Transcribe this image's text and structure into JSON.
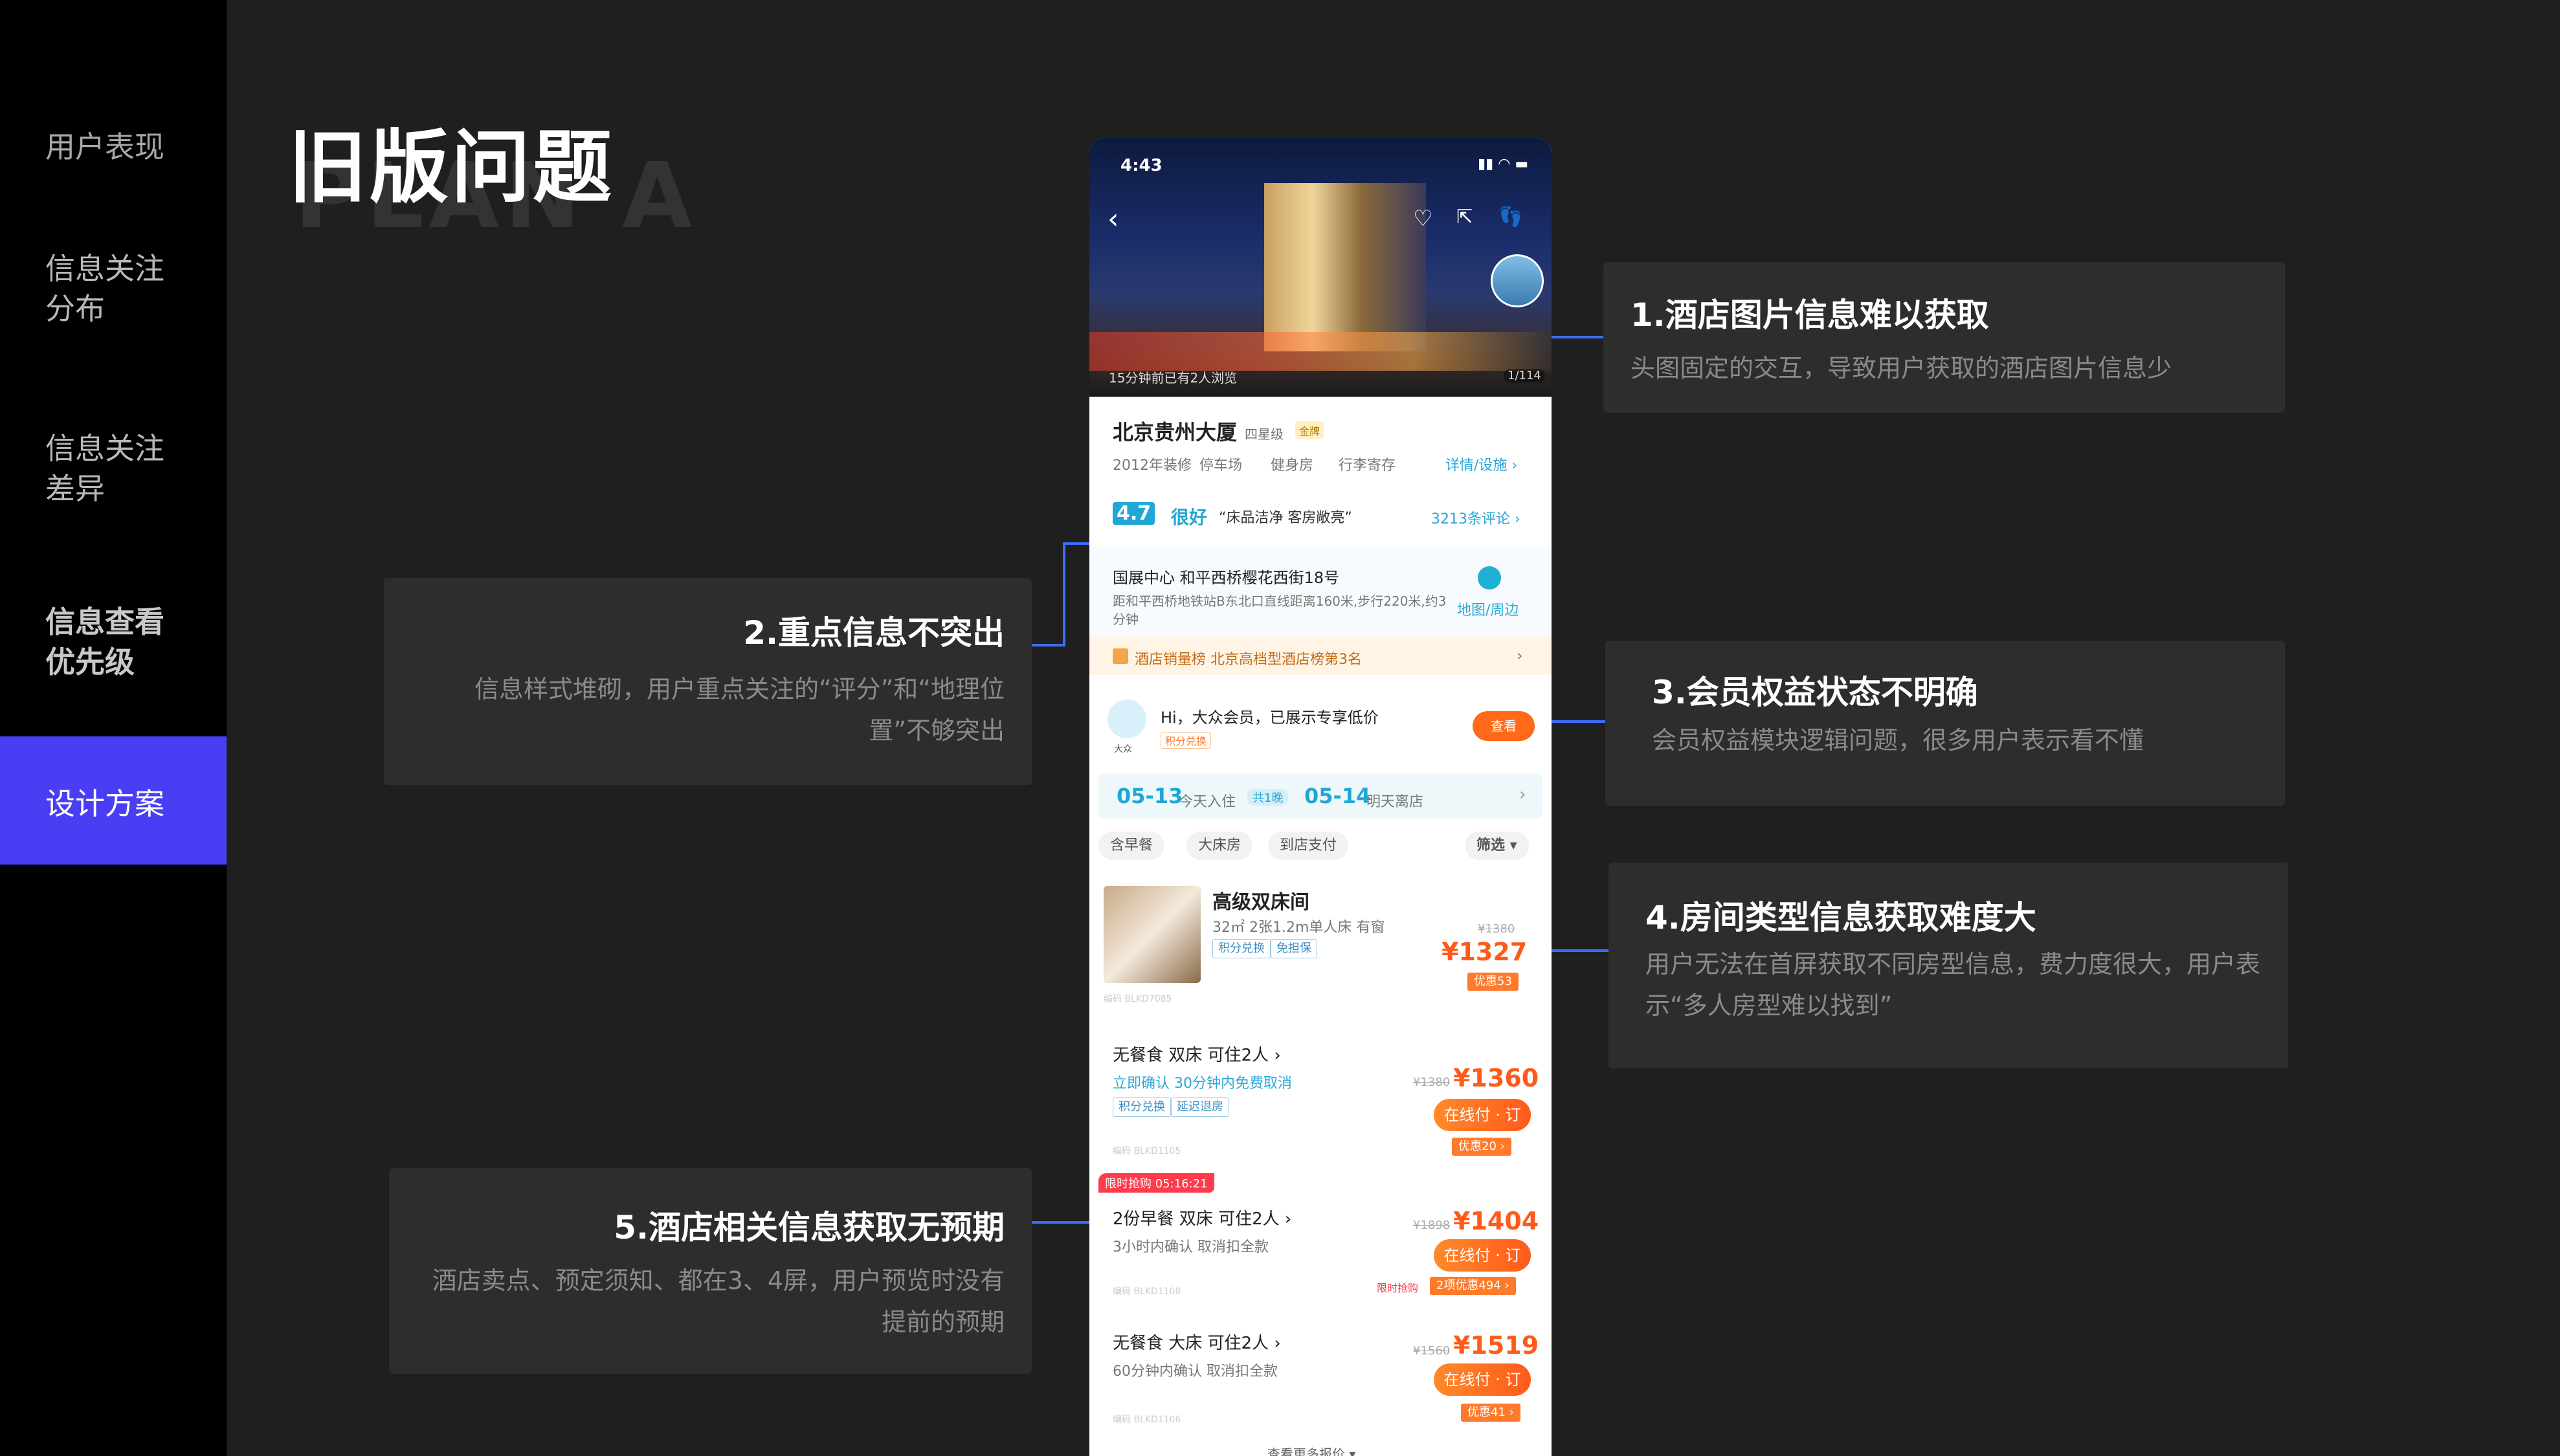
{
  "sidebar": {
    "items": [
      "用户表现",
      "信息关注\n分布",
      "信息关注\n差异",
      "信息查看\n优先级",
      "设计方案"
    ],
    "active_index": 4
  },
  "page": {
    "title": "旧版问题",
    "watermark": "PLAN A"
  },
  "annotations": [
    {
      "title": "1.酒店图片信息难以获取",
      "desc": "头图固定的交互，导致用户获取的酒店图片信息少"
    },
    {
      "title": "2.重点信息不突出",
      "desc": "信息样式堆砌，用户重点关注的“评分”和“地理位置”不够突出"
    },
    {
      "title": "3.会员权益状态不明确",
      "desc": "会员权益模块逻辑问题，很多用户表示看不懂"
    },
    {
      "title": "4.房间类型信息获取难度大",
      "desc": "用户无法在首屏获取不同房型信息，费力度很大，用户表示“多人房型难以找到”"
    },
    {
      "title": "5.酒店相关信息获取无预期",
      "desc": "酒店卖点、预定须知、都在3、4屏，用户预览时没有提前的预期"
    }
  ],
  "phone": {
    "status_time": "4:43",
    "viewed_text": "15分钟前已有2人浏览",
    "photo_count": "1/114",
    "hotel_name": "北京贵州大厦",
    "star_level": "四星级",
    "gold_badge": "金牌",
    "features": [
      "2012年装修",
      "停车场",
      "健身房",
      "行李寄存"
    ],
    "details_link": "详情/设施 ›",
    "score": "4.7",
    "score_word": "很好",
    "review_quote": "“床品洁净  客房敞亮”",
    "review_count": "3213条评论 ›",
    "addr_title": "国展中心   和平西桥樱花西街18号",
    "addr_detail": "距和平西桥地铁站B东北口直线距离160米,步行220米,约3分钟",
    "map_label": "地图/周边",
    "rank_text": "酒店销量榜  北京高档型酒店榜第3名",
    "member_greeting": "Hi，大众会员，已展示专享低价",
    "member_tag": "积分兑换",
    "member_avatar_label": "大众",
    "member_btn": "查看",
    "checkin_date": "05-13",
    "checkin_label": "今天入住",
    "nights": "共1晚",
    "checkout_date": "05-14",
    "checkout_label": "明天离店",
    "filters": [
      "含早餐",
      "大床房",
      "到店支付"
    ],
    "filter_btn": "筛选 ▾",
    "room_name": "高级双床间",
    "room_spec": "32㎡  2张1.2m单人床  有窗",
    "room_tags": [
      "积分兑换",
      "免担保"
    ],
    "room_orig": "¥1380",
    "room_price": "¥1327",
    "room_badge": "优惠53",
    "room_code": "编码 BLKD7085",
    "offers": [
      {
        "title": "无餐食   双床   可住2人 ›",
        "sub": "立即确认   30分钟内免费取消",
        "tags": [
          "积分兑换",
          "延迟退房"
        ],
        "orig": "¥1380",
        "price": "¥1360",
        "btn": "在线付 · 订",
        "badge": "优惠20 ›",
        "code": "编码 BLKD1105",
        "flash": ""
      },
      {
        "title": "2份早餐   双床   可住2人 ›",
        "sub": "3小时内确认   取消扣全款",
        "tags": [],
        "orig": "¥1898",
        "price": "¥1404",
        "btn": "在线付 · 订",
        "badge": "2项优惠494 ›",
        "code": "编码 BLKD1108",
        "flash": "限时抢购  05:16:21",
        "flash_small": "限时抢购"
      },
      {
        "title": "无餐食   大床   可住2人 ›",
        "sub": "60分钟内确认   取消扣全款",
        "tags": [],
        "orig": "¥1560",
        "price": "¥1519",
        "btn": "在线付 · 订",
        "badge": "优惠41 ›",
        "code": "编码 BLKD1106",
        "flash": ""
      }
    ],
    "more_prices": "查看更多报价 ▾"
  },
  "colors": {
    "accent": "#4a3ef5",
    "line": "#3d6cff",
    "price": "#ff5a1a",
    "link": "#29a7d6"
  },
  "icons": [
    "back-icon",
    "heart-icon",
    "share-icon",
    "footprint-icon",
    "map-pin-icon",
    "trophy-icon",
    "info-icon"
  ]
}
